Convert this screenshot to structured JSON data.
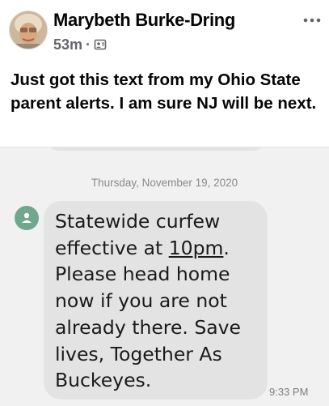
{
  "post": {
    "author": "Marybeth Burke-Dring",
    "time": "53m",
    "separator": "·",
    "audience_icon": "friends-audience-icon",
    "more_icon": "more-options-icon",
    "text": "Just got this text from my Ohio State parent alerts. I am sure NJ will be next."
  },
  "sms": {
    "date": "Thursday, November 19, 2020",
    "message_before": "Statewide curfew effective at ",
    "message_link": "10pm",
    "message_after": ". Please head home now if you are not already there. Save lives, Together As Buckeyes.",
    "time": "9:33 PM",
    "contact_icon": "person-icon"
  },
  "colors": {
    "author_text": "#050505",
    "meta_text": "#65676b",
    "sms_background": "#f1f1f1",
    "bubble": "#e3e3e3",
    "contact_avatar": "#6fa88b"
  }
}
